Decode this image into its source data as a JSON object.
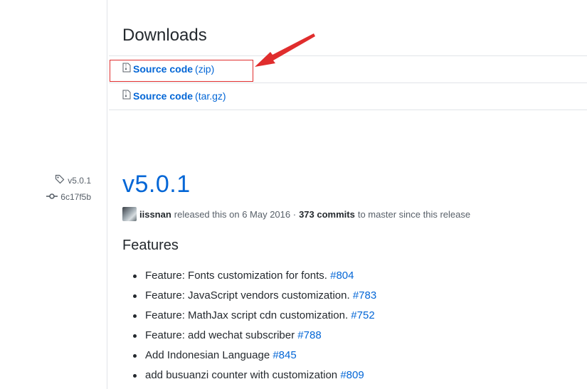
{
  "sidebar": {
    "tag_label": "v5.0.1",
    "commit_label": "6c17f5b"
  },
  "downloads": {
    "title": "Downloads",
    "items": [
      {
        "label": "Source code",
        "ext": "(zip)"
      },
      {
        "label": "Source code",
        "ext": "(tar.gz)"
      }
    ]
  },
  "release": {
    "title": "v5.0.1",
    "author": "iissnan",
    "released_text": "released this on 6 May 2016 ·",
    "commits_count": "373 commits",
    "commits_suffix": "to master since this release"
  },
  "features": {
    "title": "Features",
    "items": [
      {
        "text": "Feature: Fonts customization for fonts.",
        "ref": "#804"
      },
      {
        "text": "Feature: JavaScript vendors customization.",
        "ref": "#783"
      },
      {
        "text": "Feature: MathJax script cdn customization.",
        "ref": "#752"
      },
      {
        "text": "Feature: add wechat subscriber",
        "ref": "#788"
      },
      {
        "text": "Add Indonesian Language",
        "ref": "#845"
      },
      {
        "text": "add busuanzi counter with customization",
        "ref": "#809"
      }
    ]
  },
  "annotation": {
    "color": "#e02d2d"
  },
  "icons": {
    "tag": "tag-icon",
    "commit": "commit-icon",
    "zip_file": "file-zip-icon"
  }
}
